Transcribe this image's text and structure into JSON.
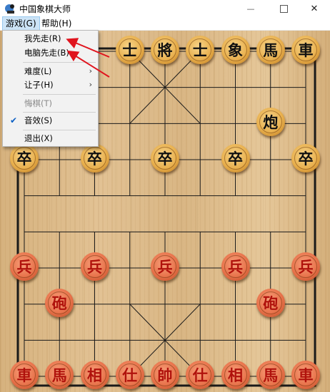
{
  "window": {
    "title": "中国象棋大师",
    "minimize_symbol": "—",
    "close_symbol": "✕"
  },
  "menubar": {
    "game": "游戏(G)",
    "help": "帮助(H)"
  },
  "dropdown": {
    "items": [
      {
        "label": "我先走(R)"
      },
      {
        "label": "电脑先走(B)"
      },
      {
        "label": "难度(L)",
        "arrow": "›"
      },
      {
        "label": "让子(H)",
        "arrow": "›"
      },
      {
        "label": "悔棋(T)",
        "disabled": true
      },
      {
        "label": "音效(S)",
        "checked": true,
        "check": "✔"
      },
      {
        "label": "退出(X)"
      }
    ]
  },
  "annotation": {
    "color": "#e0141e"
  },
  "pieces": {
    "black_top": [
      "士",
      "將",
      "士",
      "象",
      "馬",
      "車"
    ],
    "black_cannon": "炮",
    "black_pawns": [
      "卒",
      "卒",
      "卒",
      "卒",
      "卒"
    ],
    "red_pawns": [
      "兵",
      "兵",
      "兵",
      "兵",
      "兵"
    ],
    "red_cannons": [
      "砲",
      "砲"
    ],
    "red_back": [
      "車",
      "馬",
      "相",
      "仕",
      "帥",
      "仕",
      "相",
      "馬",
      "車"
    ]
  }
}
